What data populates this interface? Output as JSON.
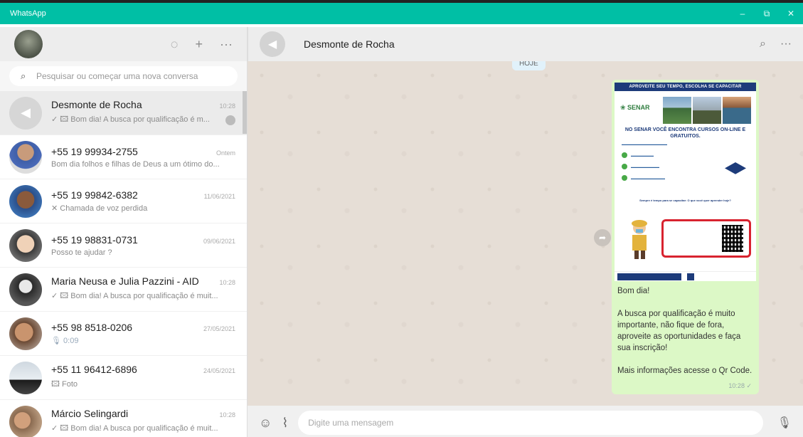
{
  "window": {
    "title": "WhatsApp",
    "controls": [
      "–",
      "⧉",
      "✕"
    ]
  },
  "sidebar": {
    "header_icons": [
      "status-icon",
      "new-chat-icon",
      "menu-icon"
    ],
    "search_placeholder": "Pesquisar ou começar uma nova conversa",
    "chats": [
      {
        "name": "Desmonte de Rocha",
        "time": "10:28",
        "preview": "✓ 🖾 Bom dia! A busca por qualificação é m...",
        "active": true
      },
      {
        "name": "+55 19 99934-2755",
        "time": "Ontem",
        "preview": "Bom dia folhos e filhas de Deus a um ótimo do..."
      },
      {
        "name": "+55 19 99842-6382",
        "time": "11/06/2021",
        "preview": "✕ Chamada de voz perdida"
      },
      {
        "name": "+55 19 98831-0731",
        "time": "09/06/2021",
        "preview": "Posso te ajudar ?"
      },
      {
        "name": "Maria Neusa e Julia Pazzini - AID",
        "time": "10:28",
        "preview": "✓ 🖾 Bom dia! A busca por qualificação é muit..."
      },
      {
        "name": "+55 98 8518-0206",
        "time": "27/05/2021",
        "preview": "🎙 0:09"
      },
      {
        "name": "+55 11 96412-6896",
        "time": "24/05/2021",
        "preview": "🖾 Foto"
      },
      {
        "name": "Márcio Selingardi",
        "time": "10:28",
        "preview": "✓ 🖾 Bom dia! A busca por qualificação é muit..."
      }
    ]
  },
  "conversation": {
    "title": "Desmonte de Rocha",
    "date_badge": "HOJE",
    "message": {
      "flyer": {
        "top_banner": "APROVEITE SEU TEMPO, ESCOLHA SE CAPACITAR",
        "logo": "SENAR",
        "headline": "NO SENAR VOCÊ ENCONTRA CURSOS ON-LINE E GRATUITOS.",
        "mid_text": "Sempre é tempo para se capacitar: O que você quer aprender hoje?"
      },
      "text": "Bom dia!\n\nA busca por qualificação é muito importante, não fique de fora, aproveite as oportunidades e faça sua inscrição!\n\nMais informações acesse o Qr Code.",
      "time": "10:28 ✓"
    },
    "input_placeholder": "Digite uma mensagem"
  }
}
